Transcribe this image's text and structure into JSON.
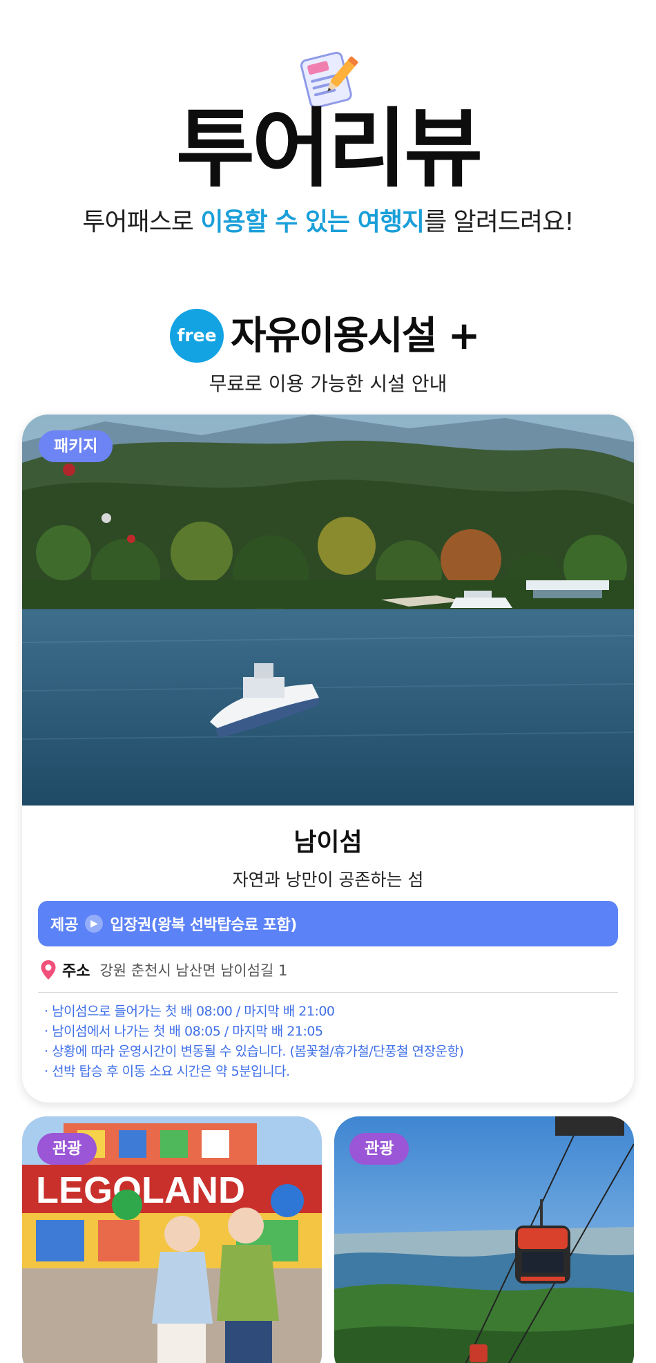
{
  "hero": {
    "title": "투어리뷰",
    "subtitle_pre": "투어패스로 ",
    "subtitle_highlight1": "이용할 수 있는 여행지",
    "subtitle_post": "를 알려드려요!",
    "icon": "memo-pencil-icon"
  },
  "section": {
    "badge": "free",
    "title": "자유이용시설 +",
    "subtitle": "무료로 이용 가능한 시설 안내"
  },
  "main_card": {
    "tag": "패키지",
    "name": "남이섬",
    "description": "자연과 낭만이 공존하는 섬",
    "provide_label": "제공",
    "provide_value": "입장권(왕복 선박탑승료 포함)",
    "address_label": "주소",
    "address_value": "강원 춘천시 남산면 남이섬길 1",
    "notes": [
      "남이섬으로 들어가는 첫 배 08:00 / 마지막 배 21:00",
      "남이섬에서 나가는 첫 배 08:05 / 마지막 배 21:05",
      "상황에 따라 운영시간이 변동될 수 있습니다. (봄꽃철/휴가철/단풍철 연장운항)",
      "선박 탑승 후 이동 소요 시간은 약 5분입니다."
    ]
  },
  "mini_cards": [
    {
      "tag": "관광",
      "sign_text": "LEGOLAND"
    },
    {
      "tag": "관광"
    }
  ],
  "colors": {
    "accent_blue": "#1a9fd9",
    "provide_bar": "#5b82f6",
    "note_text": "#3f6fe8",
    "tag_package": "#6d84f5",
    "tag_tour": "#9a56d6"
  }
}
